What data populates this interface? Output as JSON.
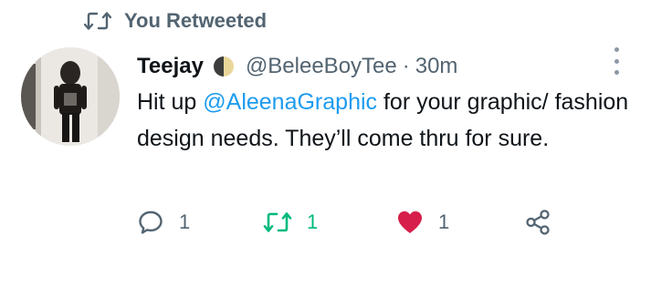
{
  "retweet_context": {
    "label": "You Retweeted"
  },
  "author": {
    "name": "Teejay",
    "handle": "@BeleeBoyTee",
    "separator": "·",
    "time": "30m"
  },
  "body": {
    "prefix": "Hit up ",
    "mention": "@AleenaGraphic",
    "suffix": " for your graphic/ fashion design needs. They’ll come thru for sure."
  },
  "actions": {
    "reply_count": "1",
    "retweet_count": "1",
    "like_count": "1"
  },
  "colors": {
    "accent": "#1d9bf0",
    "retweeted": "#00ba7c",
    "liked": "#d61f4a",
    "muted": "#536471"
  },
  "icons": {
    "retweet_context": "retweet-icon",
    "reply": "reply-icon",
    "retweet": "retweet-icon",
    "like": "heart-icon",
    "share": "share-icon",
    "more": "more-options-icon",
    "badge": "half-moon-badge-icon"
  }
}
